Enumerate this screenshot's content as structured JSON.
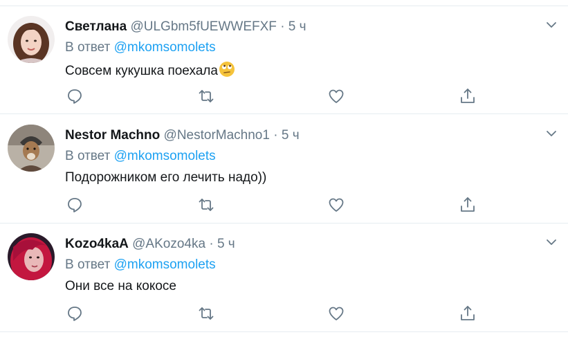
{
  "colors": {
    "text_primary": "#14171a",
    "text_secondary": "#657786",
    "link": "#1da1f2",
    "divider": "#e6ecf0"
  },
  "tweets": [
    {
      "name": "Светлана",
      "handle": "@ULGbm5fUEWWEFXF",
      "separator": "·",
      "time": "5 ч",
      "reply_prefix": "В ответ",
      "reply_to": "@mkomsomolets",
      "text": "Совсем кукушка поехала",
      "emoji": "rolling-eyes-emoji",
      "avatar": "avatar-woman-dark-hair"
    },
    {
      "name": "Nestor Machno",
      "handle": "@NestorMachno1",
      "separator": "·",
      "time": "5 ч",
      "reply_prefix": "В ответ",
      "reply_to": "@mkomsomolets",
      "text": "Подорожником его лечить надо))",
      "avatar": "avatar-dog-in-hat"
    },
    {
      "name": "Kozo4kaA",
      "handle": "@AKozo4ka",
      "separator": "·",
      "time": "5 ч",
      "reply_prefix": "В ответ",
      "reply_to": "@mkomsomolets",
      "text": "Они все на кокосе",
      "avatar": "avatar-woman-red-hair"
    }
  ],
  "icons": {
    "menu": "chevron-down-icon",
    "reply": "reply-icon",
    "retweet": "retweet-icon",
    "like": "heart-icon",
    "share": "share-icon"
  }
}
